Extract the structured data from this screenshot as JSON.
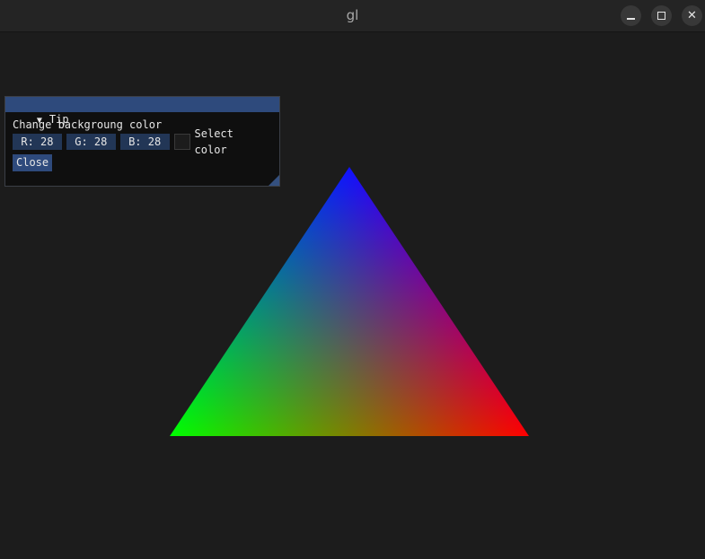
{
  "window": {
    "title": "gl",
    "minimize_icon": "minimize-icon",
    "maximize_icon": "maximize-icon",
    "close_icon": "close-icon"
  },
  "scene": {
    "background_color": "#1c1c1c",
    "vertex_colors": [
      "#0000ff",
      "#00ff00",
      "#ff0000"
    ]
  },
  "tip_panel": {
    "title": "Tip",
    "collapse_icon": "triangle-down-icon",
    "description": "Change backgroung color",
    "fields": [
      {
        "label": "R: 28"
      },
      {
        "label": "G: 28"
      },
      {
        "label": "B: 28"
      }
    ],
    "swatch_color": "#1c1c1c",
    "select_label": "Select color",
    "close_label": "Close"
  }
}
